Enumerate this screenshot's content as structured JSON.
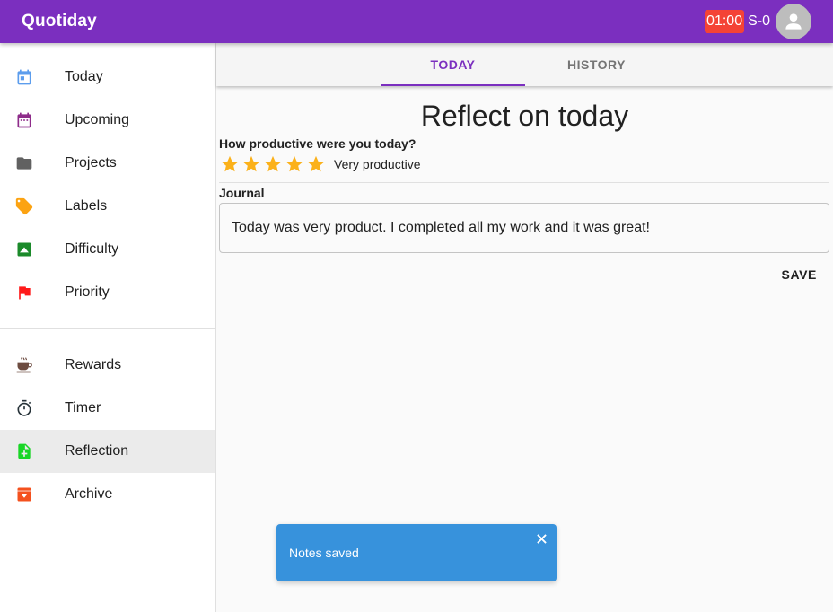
{
  "app": {
    "title": "Quotiday"
  },
  "header": {
    "timer": "01:00",
    "streak": "S-0"
  },
  "sidebar": {
    "items": [
      {
        "label": "Today",
        "icon": "calendar-today-icon",
        "color": "#5c9ded"
      },
      {
        "label": "Upcoming",
        "icon": "calendar-month-icon",
        "color": "#8e2c8a"
      },
      {
        "label": "Projects",
        "icon": "folder-icon",
        "color": "#616161"
      },
      {
        "label": "Labels",
        "icon": "label-tag-icon",
        "color": "#fca312"
      },
      {
        "label": "Difficulty",
        "icon": "difficulty-up-icon",
        "color": "#1b8a2a"
      },
      {
        "label": "Priority",
        "icon": "flag-icon",
        "color": "#ff1a1a"
      },
      {
        "label": "Rewards",
        "icon": "coffee-cup-icon",
        "color": "#6d4c41"
      },
      {
        "label": "Timer",
        "icon": "stopwatch-icon",
        "color": "#263238"
      },
      {
        "label": "Reflection",
        "icon": "note-add-icon",
        "color": "#19d626"
      },
      {
        "label": "Archive",
        "icon": "archive-icon",
        "color": "#f4511e"
      }
    ],
    "active": "Reflection"
  },
  "tabs": [
    {
      "label": "TODAY",
      "active": true
    },
    {
      "label": "HISTORY",
      "active": false
    }
  ],
  "reflection": {
    "title": "Reflect on today",
    "question": "How productive were you today?",
    "rating": 5,
    "rating_max": 5,
    "rating_label": "Very productive",
    "journal_label": "Journal",
    "journal_text": "Today was very product. I completed all my work and it was great!",
    "save_label": "SAVE"
  },
  "toast": {
    "message": "Notes saved"
  },
  "colors": {
    "primary": "#7b2fbf",
    "timer_bg": "#f44336",
    "star": "#fbb11a",
    "toast_bg": "#3792dc"
  }
}
